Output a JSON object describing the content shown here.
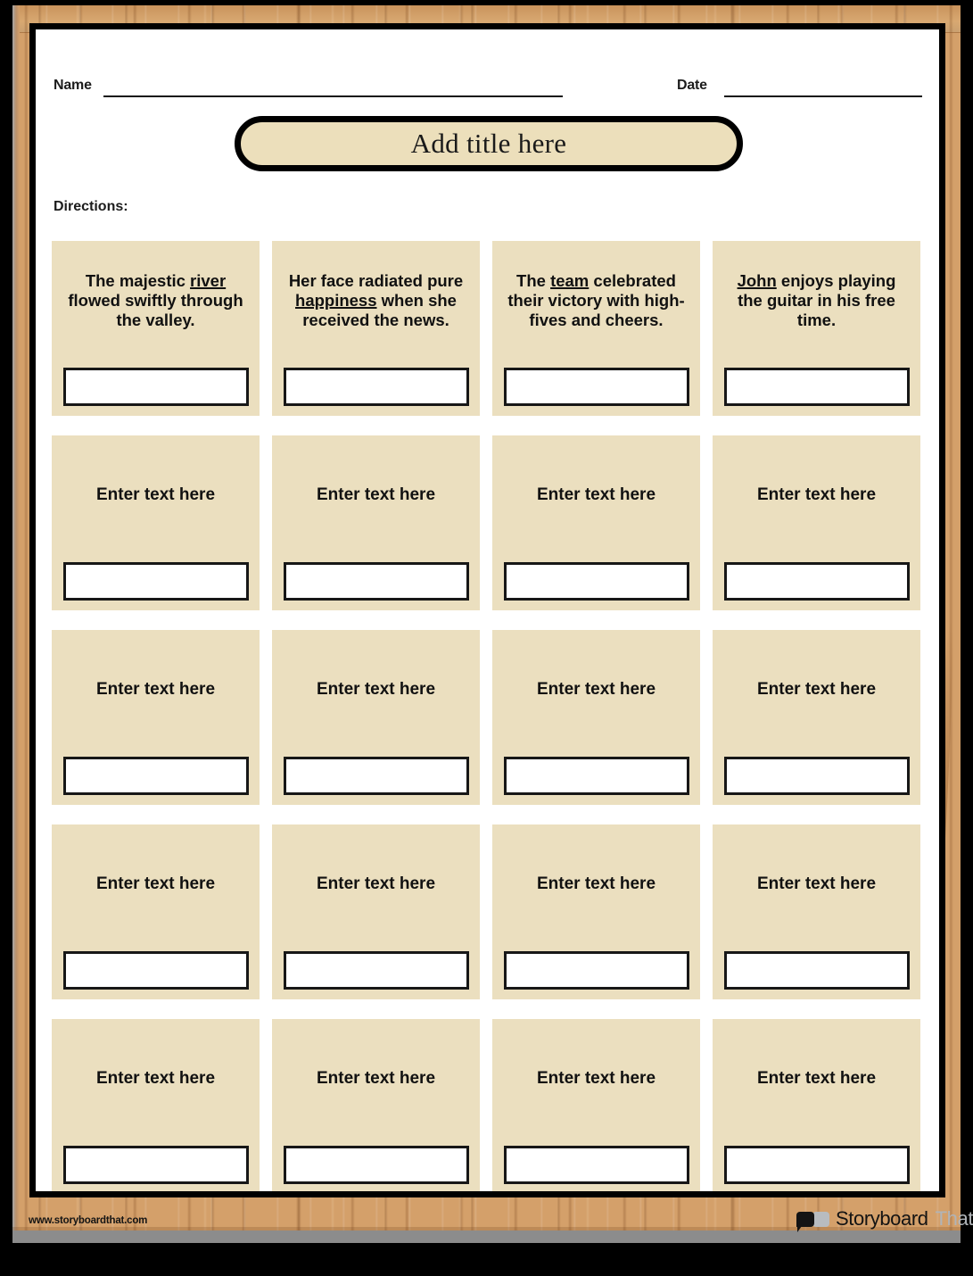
{
  "header": {
    "name_label": "Name",
    "date_label": "Date",
    "title": "Add title here",
    "directions_label": "Directions:"
  },
  "colors": {
    "wood": "#d4a06a",
    "card_bg": "#ebdfbf",
    "title_bg": "#ecdfbb",
    "sheet_bg": "#ffffff",
    "border": "#000000",
    "logo_grey": "#b0b4b8"
  },
  "grid": {
    "columns": 4,
    "rows": 5,
    "placeholder_text": "Enter text here",
    "cells": [
      [
        {
          "type": "sentence",
          "parts": [
            {
              "text": "The majestic ",
              "underline": false
            },
            {
              "text": "river",
              "underline": true
            },
            {
              "text": " flowed swiftly through the valley.",
              "underline": false
            }
          ],
          "plain": "The majestic river flowed swiftly through the valley.",
          "answer": ""
        },
        {
          "type": "sentence",
          "parts": [
            {
              "text": "Her face radiated pure ",
              "underline": false
            },
            {
              "text": "happiness",
              "underline": true
            },
            {
              "text": " when she received the news.",
              "underline": false
            }
          ],
          "plain": "Her face radiated pure happiness when she received the news.",
          "answer": ""
        },
        {
          "type": "sentence",
          "parts": [
            {
              "text": "The ",
              "underline": false
            },
            {
              "text": "team",
              "underline": true
            },
            {
              "text": " celebrated their victory with high-fives and cheers.",
              "underline": false
            }
          ],
          "plain": "The team celebrated their victory with high-fives and cheers.",
          "answer": ""
        },
        {
          "type": "sentence",
          "parts": [
            {
              "text": "John",
              "underline": true
            },
            {
              "text": " enjoys playing the guitar in his free time.",
              "underline": false
            }
          ],
          "plain": "John enjoys playing the guitar in his free time.",
          "answer": ""
        }
      ],
      [
        {
          "type": "placeholder",
          "plain": "Enter text here",
          "answer": ""
        },
        {
          "type": "placeholder",
          "plain": "Enter text here",
          "answer": ""
        },
        {
          "type": "placeholder",
          "plain": "Enter text here",
          "answer": ""
        },
        {
          "type": "placeholder",
          "plain": "Enter text here",
          "answer": ""
        }
      ],
      [
        {
          "type": "placeholder",
          "plain": "Enter text here",
          "answer": ""
        },
        {
          "type": "placeholder",
          "plain": "Enter text here",
          "answer": ""
        },
        {
          "type": "placeholder",
          "plain": "Enter text here",
          "answer": ""
        },
        {
          "type": "placeholder",
          "plain": "Enter text here",
          "answer": ""
        }
      ],
      [
        {
          "type": "placeholder",
          "plain": "Enter text here",
          "answer": ""
        },
        {
          "type": "placeholder",
          "plain": "Enter text here",
          "answer": ""
        },
        {
          "type": "placeholder",
          "plain": "Enter text here",
          "answer": ""
        },
        {
          "type": "placeholder",
          "plain": "Enter text here",
          "answer": ""
        }
      ],
      [
        {
          "type": "placeholder",
          "plain": "Enter text here",
          "answer": ""
        },
        {
          "type": "placeholder",
          "plain": "Enter text here",
          "answer": ""
        },
        {
          "type": "placeholder",
          "plain": "Enter text here",
          "answer": ""
        },
        {
          "type": "placeholder",
          "plain": "Enter text here",
          "answer": ""
        }
      ]
    ]
  },
  "footer": {
    "url": "www.storyboardthat.com",
    "logo_primary": "Storyboard",
    "logo_secondary": "That"
  }
}
